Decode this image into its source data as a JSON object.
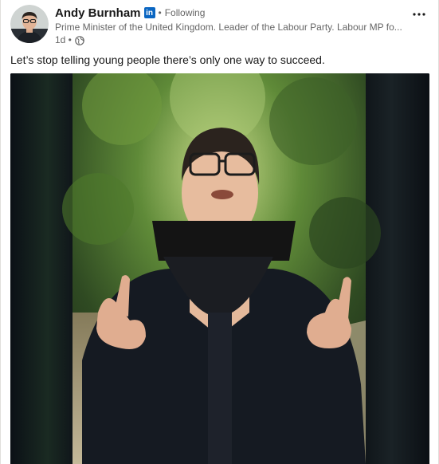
{
  "post": {
    "author_name": "Andy Burnham",
    "network_badge": "in",
    "separator": "•",
    "follow_status": "Following",
    "headline": "Prime Minister of the United Kingdom. Leader of the Labour Party. Labour MP fo...",
    "time_ago": "1d •",
    "text": "Let’s stop telling young people there’s only one way to succeed.",
    "visibility_icon": "globe-icon",
    "menu_icon": "more-horizontal-icon"
  },
  "colors": {
    "linkedin_blue": "#0a66c2",
    "secondary_text": "#666666",
    "primary_text": "#191919"
  }
}
